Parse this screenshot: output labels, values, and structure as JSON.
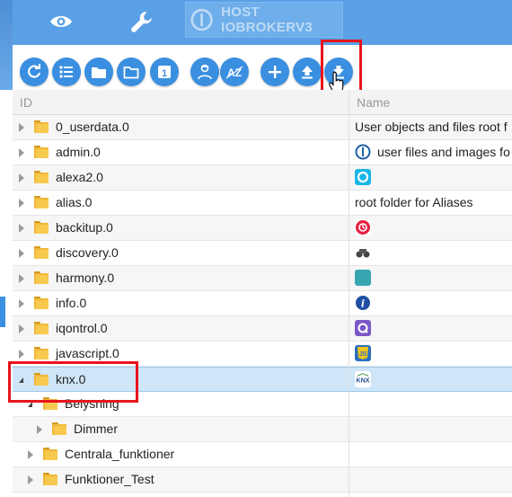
{
  "header": {
    "host_label": "HOST IOBROKERV3",
    "icons": [
      "eye-icon",
      "wrench-icon",
      "iobroker-logo-icon"
    ]
  },
  "toolbar": {
    "buttons": [
      {
        "name": "refresh-icon"
      },
      {
        "name": "list-icon"
      },
      {
        "name": "folder-icon"
      },
      {
        "name": "folder-outline-icon"
      },
      {
        "name": "number-one-icon",
        "label": "1"
      },
      {
        "name": "user-expert-icon"
      },
      {
        "name": "sort-az-icon",
        "label": "AZ"
      },
      {
        "name": "add-icon"
      },
      {
        "name": "upload-icon"
      },
      {
        "name": "download-icon"
      }
    ]
  },
  "table": {
    "columns": [
      "ID",
      "Name"
    ],
    "rows": [
      {
        "id": "0_userdata.0",
        "name": "User objects and files root f",
        "icon": ""
      },
      {
        "id": "admin.0",
        "name": "user files and images fo",
        "icon": "iobroker"
      },
      {
        "id": "alexa2.0",
        "name": "",
        "icon": "alexa"
      },
      {
        "id": "alias.0",
        "name": "root folder for Aliases",
        "icon": ""
      },
      {
        "id": "backitup.0",
        "name": "",
        "icon": "backitup"
      },
      {
        "id": "discovery.0",
        "name": "",
        "icon": "discovery"
      },
      {
        "id": "harmony.0",
        "name": "",
        "icon": "harmony"
      },
      {
        "id": "info.0",
        "name": "",
        "icon": "info"
      },
      {
        "id": "iqontrol.0",
        "name": "",
        "icon": "iqontrol"
      },
      {
        "id": "javascript.0",
        "name": "",
        "icon": "javascript"
      },
      {
        "id": "knx.0",
        "name": "",
        "icon": "knx"
      },
      {
        "id": "Belysning",
        "name": "",
        "icon": ""
      },
      {
        "id": "Dimmer",
        "name": "",
        "icon": ""
      },
      {
        "id": "Centrala_funktioner",
        "name": "",
        "icon": ""
      },
      {
        "id": "Funktioner_Test",
        "name": "",
        "icon": ""
      }
    ],
    "icon_labels": {
      "knx": "KNX",
      "javascript": "JS",
      "iqontrol": "Q",
      "info": "i"
    }
  },
  "colors": {
    "accent": "#3a8fe0",
    "highlight": "#e8141b",
    "selected_row": "#cfe6f8"
  }
}
